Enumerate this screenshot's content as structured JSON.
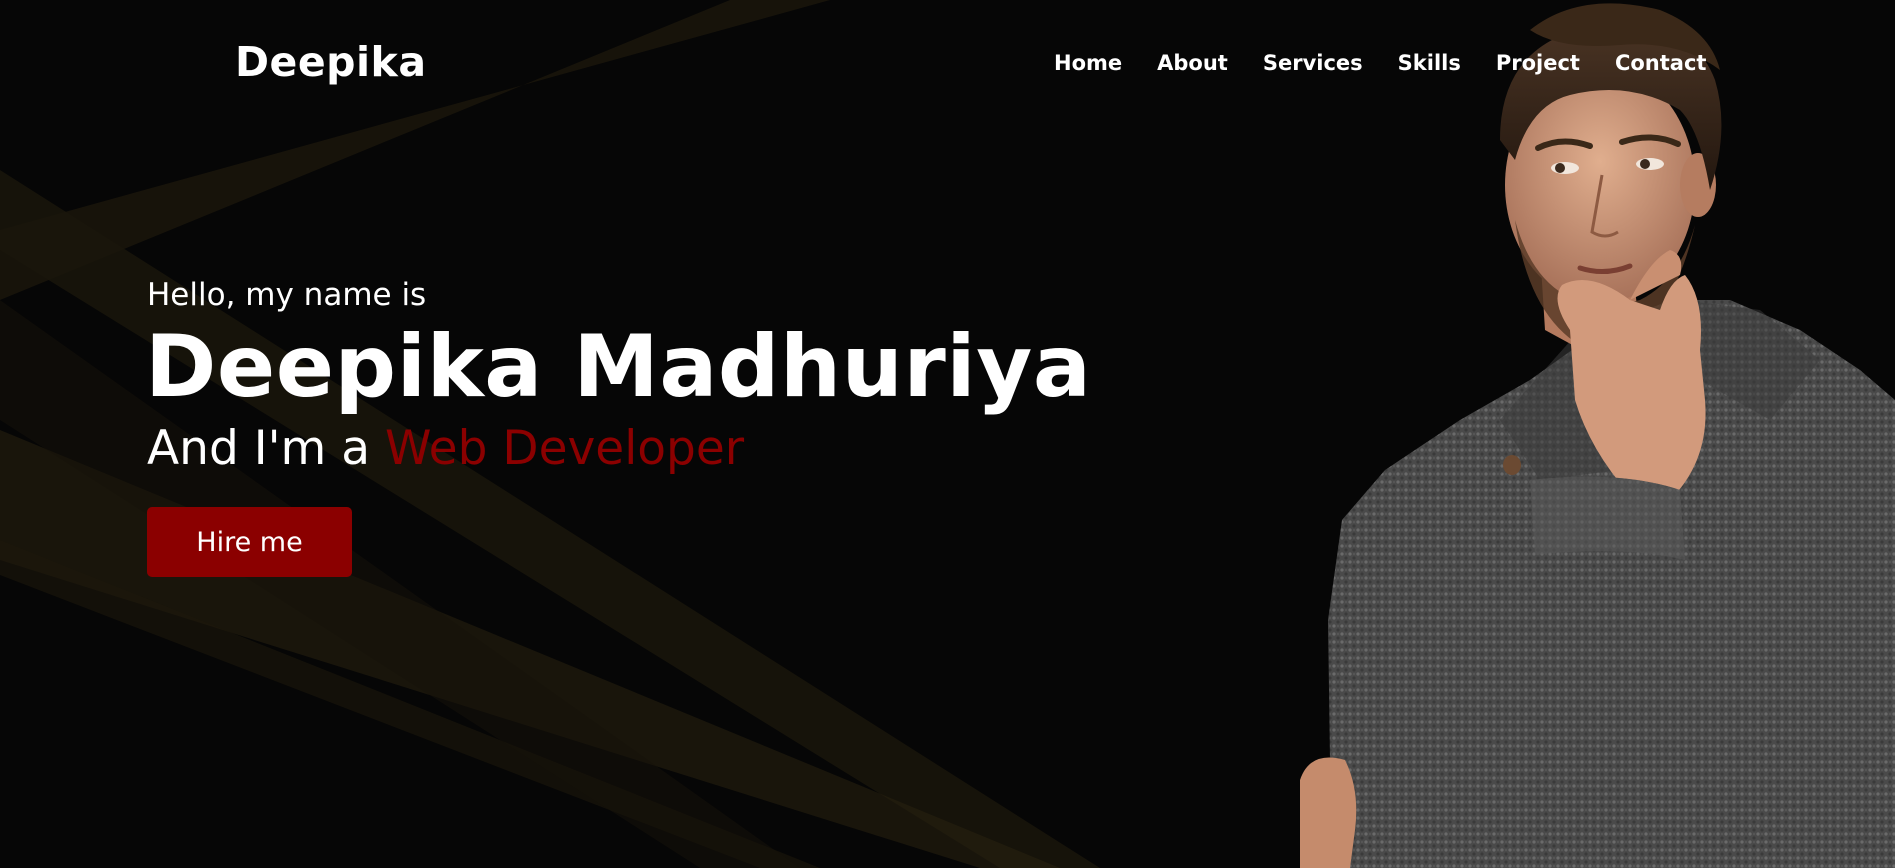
{
  "navbar": {
    "logo": "Deepika",
    "menu": [
      {
        "label": "Home"
      },
      {
        "label": "About"
      },
      {
        "label": "Services"
      },
      {
        "label": "Skills"
      },
      {
        "label": "Project"
      },
      {
        "label": "Contact"
      }
    ]
  },
  "hero": {
    "greeting": "Hello, my name is",
    "name": "Deepika Madhuriya",
    "role_prefix": "And I'm a ",
    "role_highlight": "Web Developer",
    "button_label": "Hire me",
    "portrait_alt": "portrait"
  },
  "colors": {
    "background": "#060606",
    "accent": "#8b0000",
    "text": "#ffffff",
    "beam": "#2a2110"
  }
}
